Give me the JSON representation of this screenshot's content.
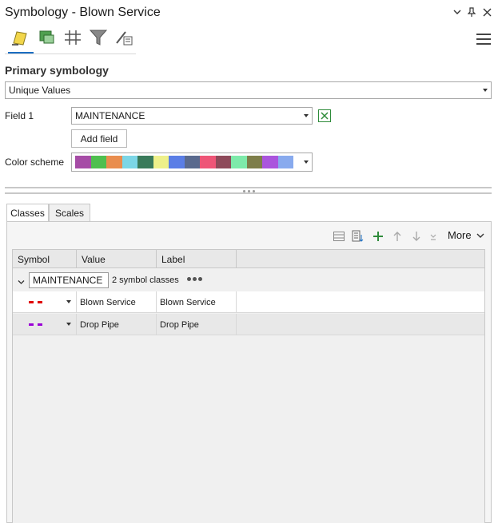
{
  "window": {
    "title": "Symbology - Blown Service"
  },
  "primary_symbology": {
    "heading": "Primary symbology",
    "method": "Unique Values"
  },
  "field1": {
    "label": "Field 1",
    "value": "MAINTENANCE",
    "add_field_label": "Add field"
  },
  "color_scheme": {
    "label": "Color scheme",
    "colors": [
      "#a64ca6",
      "#4fbf4f",
      "#e98d4e",
      "#7cd6e6",
      "#3a7a5a",
      "#eef08a",
      "#5a7ee6",
      "#5a6a8e",
      "#ee5577",
      "#8e4a5a",
      "#7eeaaa",
      "#7e7e4a",
      "#aa55dd",
      "#88aaee"
    ]
  },
  "tabs": [
    {
      "label": "Classes",
      "active": true
    },
    {
      "label": "Scales",
      "active": false
    }
  ],
  "classes_toolbar": {
    "more_label": "More"
  },
  "grid": {
    "columns": [
      "Symbol",
      "Value",
      "Label"
    ],
    "group": {
      "field": "MAINTENANCE",
      "count_text": "2 symbol classes"
    },
    "rows": [
      {
        "value": "Blown Service",
        "label": "Blown Service",
        "symbol_color": "#e00000"
      },
      {
        "value": "Drop Pipe",
        "label": "Drop Pipe",
        "symbol_color": "#9b00d6"
      }
    ]
  },
  "colors": {
    "accent": "#1b6ec2",
    "add_green": "#2e8b3a"
  }
}
